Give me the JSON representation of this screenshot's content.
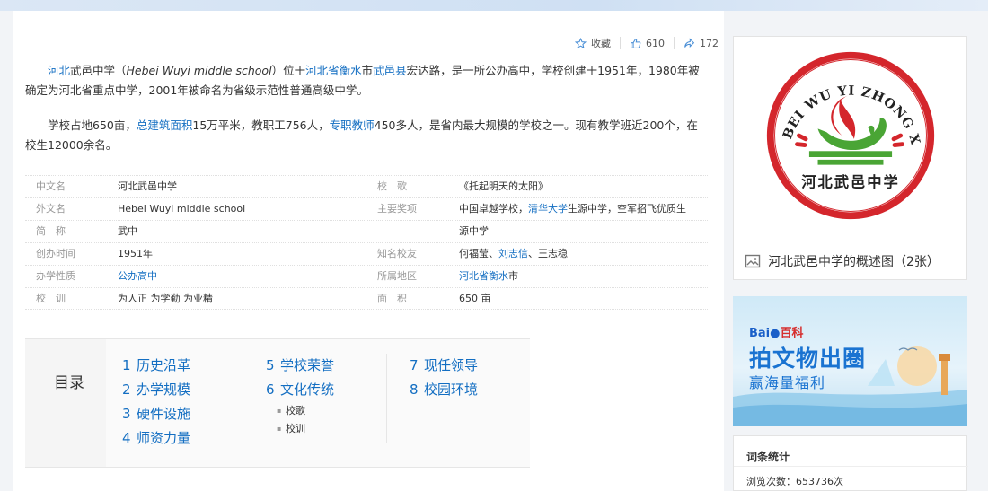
{
  "actions": {
    "favorite_label": "收藏",
    "like_count": "610",
    "share_count": "172"
  },
  "intro": {
    "p1": {
      "a": "河北",
      "b": "武邑中学（",
      "c": "Hebei Wuyi middle school",
      "d": "）位于",
      "e": "河北省",
      "f": "衡水",
      "g": "市",
      "h": "武邑县",
      "i": "宏达路，是一所公办高中，学校创建于1951年，1980年被确定为河北省重点中学，2001年被命名为省级示范性普通高级中学。"
    },
    "p2": {
      "a": "学校占地650亩，",
      "b": "总建筑面积",
      "c": "15万平米，教职工756人，",
      "d": "专职教师",
      "e": "450多人，是省内最大规模的学校之一。现有教学班近200个，在校生12000余名。"
    }
  },
  "infobox": {
    "rows": [
      {
        "l1": "中文名",
        "v1": "河北武邑中学",
        "l2": "校　歌",
        "v2": "《托起明天的太阳》"
      },
      {
        "l1": "外文名",
        "v1": "Hebei Wuyi middle school",
        "l2": "主要奖项",
        "v2a": "中国卓越学校，",
        "v2b": "清华大学",
        "v2c": "生源中学，空军招飞优质生"
      },
      {
        "l1": "简　称",
        "v1": "武中",
        "l2": "",
        "v2": "源中学"
      },
      {
        "l1": "创办时间",
        "v1": "1951年",
        "l2": "知名校友",
        "v2a": "何福莹、",
        "v2b": "刘志信",
        "v2c": "、王志稳"
      },
      {
        "l1": "办学性质",
        "v1": "公办高中",
        "l2": "所属地区",
        "v2a": "河北省",
        "v2b": "衡水",
        "v2c": "市"
      },
      {
        "l1": "校　训",
        "v1": "为人正 为学勤 为业精",
        "l2": "面　积",
        "v2": "650 亩"
      }
    ]
  },
  "toc": {
    "title": "目录",
    "col1": [
      {
        "num": "1",
        "label": "历史沿革"
      },
      {
        "num": "2",
        "label": "办学规模"
      },
      {
        "num": "3",
        "label": "硬件设施"
      },
      {
        "num": "4",
        "label": "师资力量"
      }
    ],
    "col2": [
      {
        "num": "5",
        "label": "学校荣誉"
      },
      {
        "num": "6",
        "label": "文化传统"
      }
    ],
    "col2_subs": [
      "校歌",
      "校训"
    ],
    "col3": [
      {
        "num": "7",
        "label": "现任领导"
      },
      {
        "num": "8",
        "label": "校园环境"
      }
    ]
  },
  "image_card": {
    "logo_text_top": "HE BEI WU YI ZHONG XUE",
    "logo_text_bottom": "河北武邑中学",
    "caption": "河北武邑中学的概述图（2张）"
  },
  "banner": {
    "brand_a": "Bai",
    "brand_b": "百科",
    "line1": "拍文物出圈",
    "line2": "赢海量福利"
  },
  "stats": {
    "title": "词条统计",
    "views": "浏览次数：653736次"
  },
  "colors": {
    "link": "#136ec2",
    "logo_red": "#d4262c",
    "logo_green": "#4aa535"
  }
}
